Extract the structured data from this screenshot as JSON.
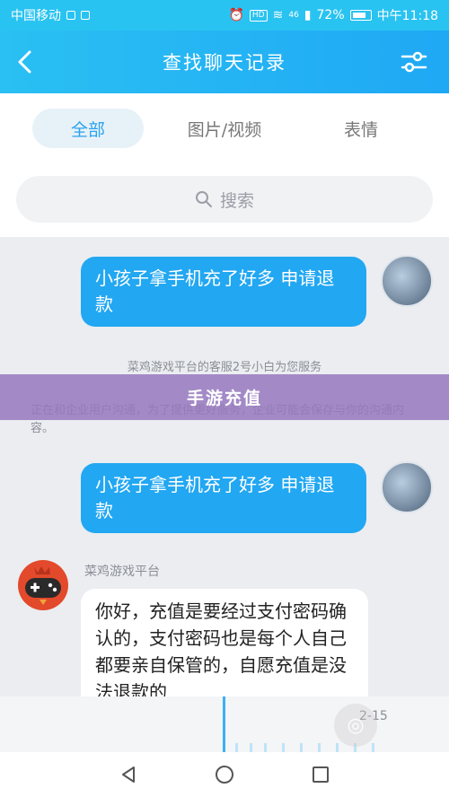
{
  "status_bar": {
    "carrier": "中国移动",
    "hd": "HD",
    "signal": "46",
    "battery": "72%",
    "time": "中午11:18"
  },
  "header": {
    "title": "查找聊天记录",
    "back_icon": "chevron-left-icon",
    "filter_icon": "sliders-icon"
  },
  "tabs": [
    {
      "label": "全部",
      "active": true
    },
    {
      "label": "图片/视频",
      "active": false
    },
    {
      "label": "表情",
      "active": false
    }
  ],
  "search": {
    "placeholder": "搜索",
    "icon": "search-icon"
  },
  "messages": {
    "out1": "小孩子拿手机充了好多 申请退款",
    "system": "菜鸡游戏平台的客服2号小白为您服务",
    "notice": "正在和企业用户沟通，为了提供更好服务，企业可能会保存与你的沟通内容。",
    "out2": "小孩子拿手机充了好多 申请退款",
    "bot_name": "菜鸡游戏平台",
    "bot_reply": "你好，充值是要经过支付密码确认的，支付密码也是每个人自己都要亲自保管的，自愿充值是没法退款的"
  },
  "banner": {
    "text": "手游充值"
  },
  "player": {
    "time": "2-15"
  },
  "navbar": {
    "back": "triangle-back-icon",
    "home": "circle-home-icon",
    "recent": "square-recent-icon"
  },
  "colors": {
    "accent": "#22a7f2",
    "header": "#29c3f1",
    "banner": "#9678be"
  }
}
